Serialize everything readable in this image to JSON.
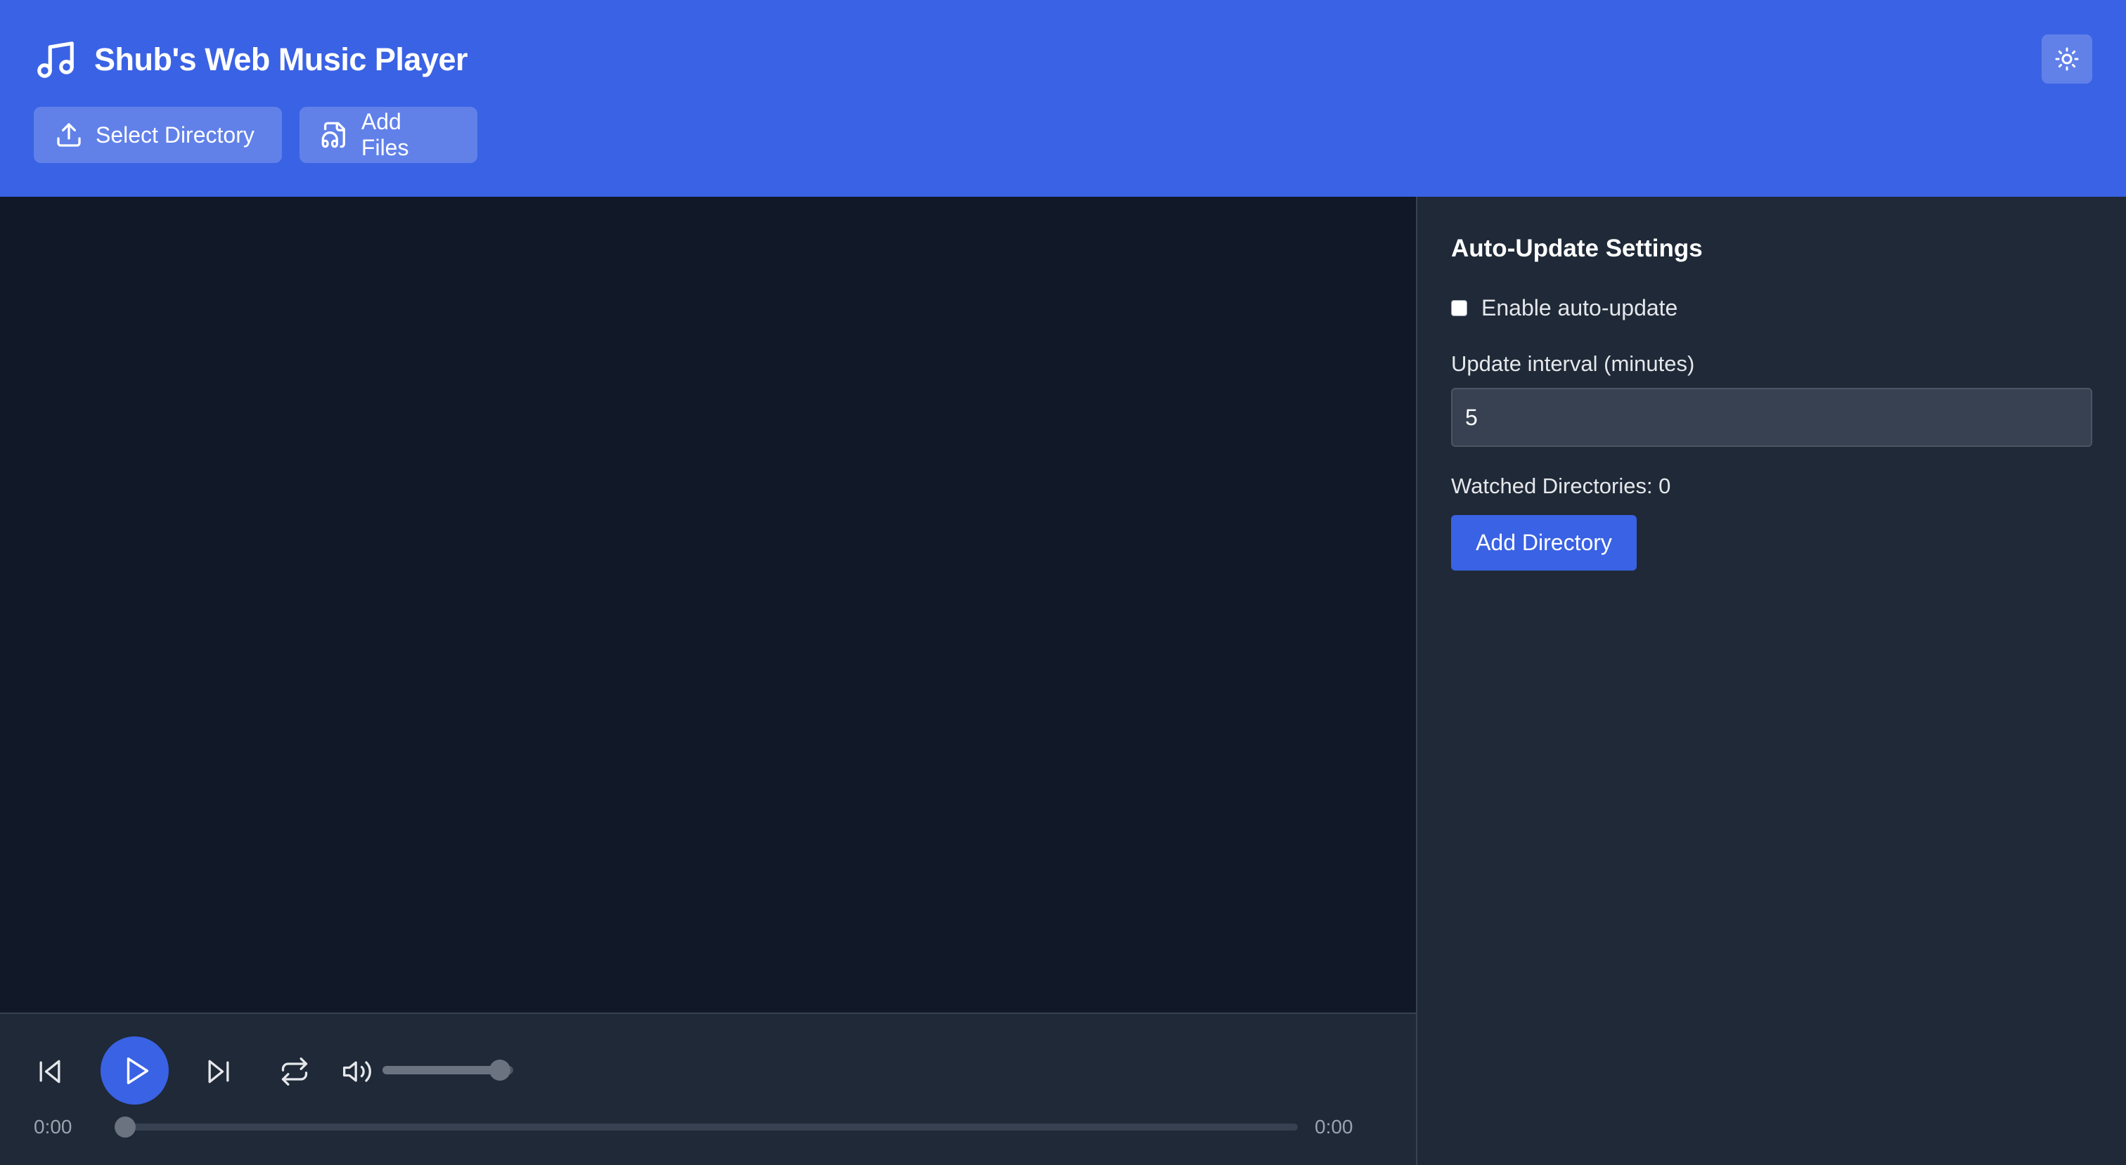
{
  "header": {
    "title": "Shub's Web Music Player",
    "buttons": {
      "select_directory": "Select Directory",
      "add_files": "Add Files"
    },
    "icons": {
      "logo": "music-note-icon",
      "theme_toggle": "sun-icon",
      "select_directory": "upload-icon",
      "add_files": "audio-file-icon"
    }
  },
  "player": {
    "current_time": "0:00",
    "total_time": "0:00",
    "progress_fraction": 0,
    "volume_fraction": 0.9,
    "icons": {
      "previous": "skip-back-icon",
      "play": "play-icon",
      "next": "skip-forward-icon",
      "repeat": "repeat-icon",
      "volume": "volume-icon"
    }
  },
  "sidebar": {
    "heading": "Auto-Update Settings",
    "auto_update_label": "Enable auto-update",
    "auto_update_checked": false,
    "interval_label": "Update interval (minutes)",
    "interval_value": "5",
    "watched_directories": "Watched Directories: 0",
    "add_directory_label": "Add Directory"
  },
  "colors": {
    "accent": "#3a62e4",
    "background": "#111827",
    "panel": "#1f2937"
  }
}
